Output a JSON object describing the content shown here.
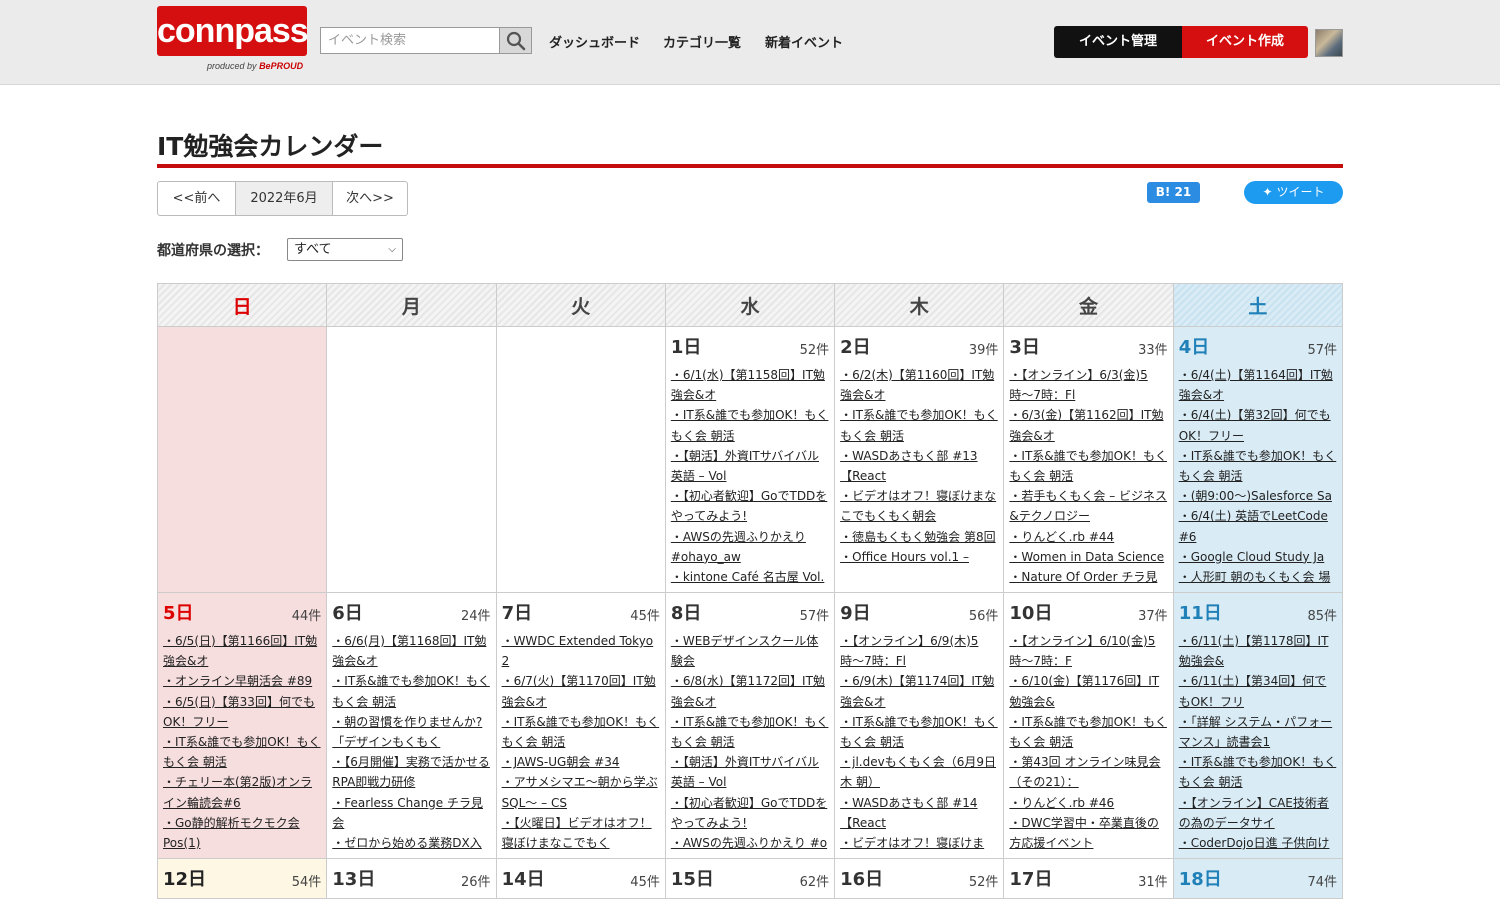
{
  "header": {
    "logo_text": "connpass",
    "logo_sub_prefix": "produced by",
    "logo_sub_brand": "BePROUD",
    "search_placeholder": "イベント検索",
    "nav": [
      "ダッシュボード",
      "カテゴリ一覧",
      "新着イベント"
    ],
    "manage_label": "イベント管理",
    "create_label": "イベント作成"
  },
  "page": {
    "title": "IT勉強会カレンダー",
    "prev_label": "<<前へ",
    "current_month": "2022年6月",
    "next_label": "次へ>>",
    "hatena_label": "B! 21",
    "tweet_label": "ツイート",
    "pref_label": "都道府県の選択：",
    "pref_value": "すべて"
  },
  "weekdays": [
    "日",
    "月",
    "火",
    "水",
    "木",
    "金",
    "土"
  ],
  "weeks": [
    [
      {
        "day": "",
        "count": "",
        "events": []
      },
      {
        "day": "",
        "count": "",
        "events": []
      },
      {
        "day": "",
        "count": "",
        "events": []
      },
      {
        "day": "1日",
        "count": "52件",
        "events": [
          "・6/1(水)【第1158回】IT勉強会&オ",
          "・IT系&誰でも参加OK！もくもく会 朝活",
          "・【朝活】外資ITサバイバル英語 – Vol",
          "・【初心者歓迎】GoでTDDをやってみよう!",
          "・AWSの先週ふりかえり #ohayo_aw",
          "・kintone Café 名古屋 Vol."
        ]
      },
      {
        "day": "2日",
        "count": "39件",
        "events": [
          "・6/2(木)【第1160回】IT勉強会&オ",
          "・IT系&誰でも参加OK！もくもく会 朝活",
          "・WASDあさもく部 #13 【React",
          "・ビデオはオフ！寝ぼけまなこでもくもく朝会",
          "・徳島もくもく勉強会 第8回",
          "・Office Hours vol.1 –"
        ]
      },
      {
        "day": "3日",
        "count": "33件",
        "events": [
          "・【オンライン】6/3(金)5時〜7時：Fl",
          "・6/3(金)【第1162回】IT勉強会&オ",
          "・IT系&誰でも参加OK！もくもく会 朝活",
          "・若手もくもく会 – ビジネス&テクノロジー",
          "・りんどく.rb #44",
          "・Women in Data Science",
          "・Nature Of Order チラ見"
        ]
      },
      {
        "day": "4日",
        "count": "57件",
        "events": [
          "・6/4(土)【第1164回】IT勉強会&オ",
          "・6/4(土)【第32回】何でもOK！フリー",
          "・IT系&誰でも参加OK！もくもく会 朝活",
          "・(朝9:00〜)Salesforce Sa",
          "・6/4(土) 英語でLeetCode #6",
          "・Google Cloud Study Ja",
          "・人形町 朝のもくもく会 場"
        ]
      }
    ],
    [
      {
        "day": "5日",
        "count": "44件",
        "events": [
          "・6/5(日)【第1166回】IT勉強会&オ",
          "・オンライン早朝活会 #89",
          "・6/5(日)【第33回】何でもOK！フリー",
          "・IT系&誰でも参加OK！もくもく会 朝活",
          "・チェリー本(第2版)オンライン輪読会#6",
          "・Go静的解析モクモク会 Pos(1)"
        ]
      },
      {
        "day": "6日",
        "count": "24件",
        "events": [
          "・6/6(月)【第1168回】IT勉強会&オ",
          "・IT系&誰でも参加OK！もくもく会 朝活",
          "・朝の習慣を作りませんか?「デザインもくもく",
          "・【6月開催】実務で活かせるRPA即戦力研修",
          "・Fearless Change チラ見会",
          "・ゼロから始める業務DX入"
        ]
      },
      {
        "day": "7日",
        "count": "45件",
        "events": [
          "・WWDC Extended Tokyo 2",
          "・6/7(火)【第1170回】IT勉強会&オ",
          "・IT系&誰でも参加OK！もくもく会 朝活",
          "・JAWS-UG朝会 #34",
          "・アサメシマエ〜朝から学ぶSQL〜 – CS",
          "・【火曜日】ビデオはオフ！寝ぼけまなこでもく"
        ]
      },
      {
        "day": "8日",
        "count": "57件",
        "events": [
          "・WEBデザインスクール体験会",
          "・6/8(水)【第1172回】IT勉強会&オ",
          "・IT系&誰でも参加OK！もくもく会 朝活",
          "・【朝活】外資ITサバイバル英語 – Vol",
          "・【初心者歓迎】GoでTDDをやってみよう!",
          "・AWSの先週ふりかえり #o"
        ]
      },
      {
        "day": "9日",
        "count": "56件",
        "events": [
          "・【オンライン】6/9(木)5時〜7時：Fl",
          "・6/9(木)【第1174回】IT勉強会&オ",
          "・IT系&誰でも参加OK！もくもく会 朝活",
          "・jl.devもくもく会（6月9日木 朝）",
          "・WASDあさもく部 #14 【React",
          "・ビデオはオフ！寝ぼけま"
        ]
      },
      {
        "day": "10日",
        "count": "37件",
        "events": [
          "・【オンライン】6/10(金)5時〜7時：F",
          "・6/10(金)【第1176回】IT勉強会&",
          "・IT系&誰でも参加OK！もくもく会 朝活",
          "・第43回 オンライン味見会（その21）：",
          "・りんどく.rb #46",
          "・DWC学習中・卒業直後の方応援イベント"
        ]
      },
      {
        "day": "11日",
        "count": "85件",
        "events": [
          "・6/11(土)【第1178回】IT勉強会&",
          "・6/11(土)【第34回】何でもOK！フリ",
          "・「詳解 システム・パフォーマンス」読書会1",
          "・IT系&誰でも参加OK！もくもく会 朝活",
          "・【オンライン】CAE技術者の為のデータサイ",
          "・CoderDojo日進 子供向け"
        ]
      }
    ],
    [
      {
        "day": "12日",
        "count": "54件",
        "events": []
      },
      {
        "day": "13日",
        "count": "26件",
        "events": []
      },
      {
        "day": "14日",
        "count": "45件",
        "events": []
      },
      {
        "day": "15日",
        "count": "62件",
        "events": []
      },
      {
        "day": "16日",
        "count": "52件",
        "events": []
      },
      {
        "day": "17日",
        "count": "31件",
        "events": []
      },
      {
        "day": "18日",
        "count": "74件",
        "events": []
      }
    ]
  ]
}
